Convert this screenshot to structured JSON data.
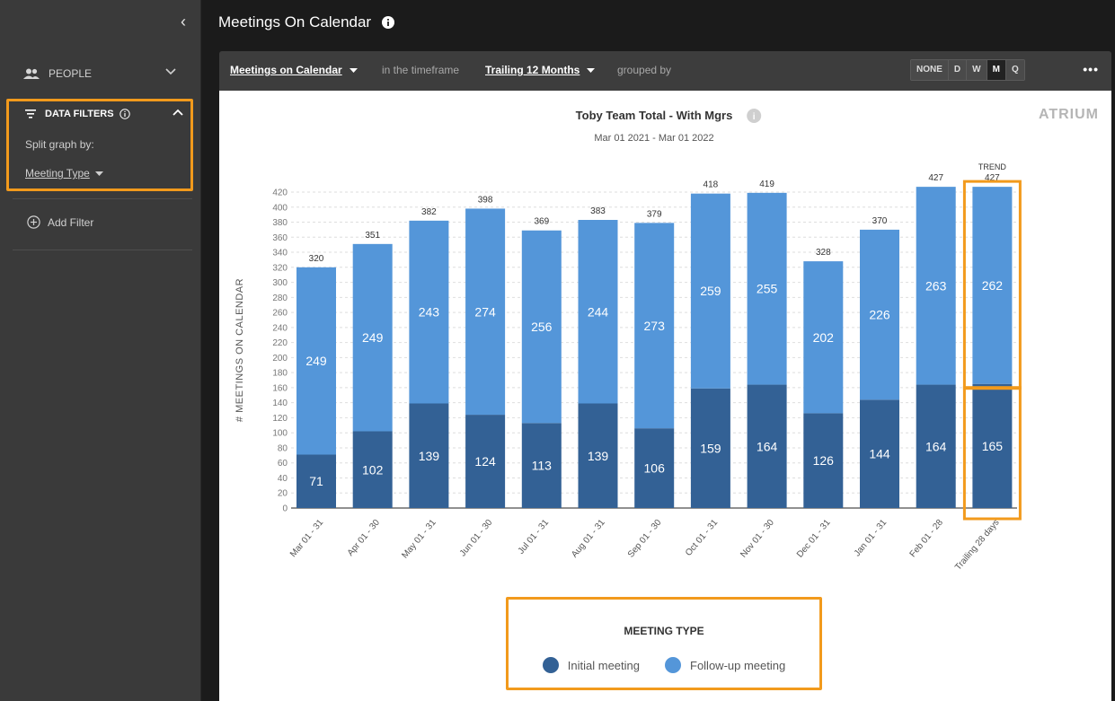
{
  "sidebar": {
    "people_label": "PEOPLE",
    "filters_label": "DATA FILTERS",
    "split_label": "Split graph by:",
    "split_value": "Meeting Type",
    "add_filter": "Add Filter"
  },
  "header": {
    "title": "Meetings On Calendar"
  },
  "toolbar": {
    "metric": "Meetings on Calendar",
    "timeframe_prefix": "in the timeframe",
    "timeframe": "Trailing 12 Months",
    "grouped_prefix": "grouped by",
    "groupings": [
      "NONE",
      "D",
      "W",
      "M",
      "Q"
    ],
    "active_grouping": "M",
    "more_label": "•••"
  },
  "brand": "ATRIUM",
  "chart_data": {
    "type": "bar",
    "stacked": true,
    "title": "Toby Team Total - With Mgrs",
    "subtitle": "Mar 01 2021 - Mar 01 2022",
    "ylabel": "# MEETINGS ON CALENDAR",
    "ylim": [
      0,
      420
    ],
    "ytick_step": 20,
    "grid": true,
    "categories": [
      "Mar 01 - 31",
      "Apr 01 - 30",
      "May 01 - 31",
      "Jun 01 - 30",
      "Jul 01 - 31",
      "Aug 01 - 31",
      "Sep 01 - 30",
      "Oct 01 - 31",
      "Nov 01 - 30",
      "Dec 01 - 31",
      "Jan 01 - 31",
      "Feb 01 - 28",
      "Trailing 28 days"
    ],
    "totals": [
      320,
      351,
      382,
      398,
      369,
      383,
      379,
      418,
      419,
      328,
      370,
      427,
      427
    ],
    "trend_label": "TREND",
    "series": [
      {
        "name": "Initial meeting",
        "color": "#336195",
        "values": [
          71,
          102,
          139,
          124,
          113,
          139,
          106,
          159,
          164,
          126,
          144,
          164,
          165
        ]
      },
      {
        "name": "Follow-up meeting",
        "color": "#5496d9",
        "values": [
          249,
          249,
          243,
          274,
          256,
          244,
          273,
          259,
          255,
          202,
          226,
          263,
          262
        ]
      }
    ],
    "legend_title": "MEETING TYPE",
    "highlight_color": "#f29a1c"
  }
}
